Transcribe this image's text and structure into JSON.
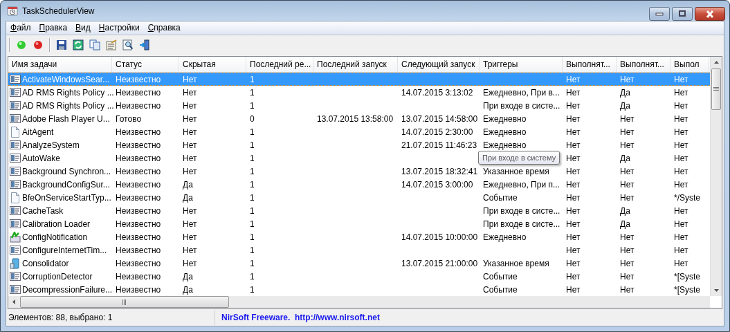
{
  "window": {
    "title": "TaskSchedulerView"
  },
  "menu": [
    {
      "label": "Файл"
    },
    {
      "label": "Правка"
    },
    {
      "label": "Вид"
    },
    {
      "label": "Настройки"
    },
    {
      "label": "Справка"
    }
  ],
  "table": {
    "columns": [
      "Имя задачи",
      "Статус",
      "Скрытая",
      "Последний ре...",
      "Последний запуск",
      "Следующий запуск",
      "Триггеры",
      "Выполнят...",
      "Выполнят...",
      "Выпол"
    ],
    "rows": [
      {
        "kind": "task",
        "selected": true,
        "name": "ActivateWindowsSear...",
        "status": "Неизвестно",
        "hidden": "Нет",
        "last_result": "1",
        "column_8": "Нет",
        "column_9": "Нет",
        "column_10": "Нет"
      },
      {
        "kind": "task",
        "selected": false,
        "name": "AD RMS Rights Policy ...",
        "status": "Неизвестно",
        "hidden": "Нет",
        "last_result": "1",
        "next_run": "14.07.2015 3:13:02",
        "triggers": "Ежедневно, При в...",
        "column_8": "Нет",
        "column_9": "Да",
        "column_10": "Нет"
      },
      {
        "kind": "task",
        "selected": false,
        "name": "AD RMS Rights Policy ...",
        "status": "Неизвестно",
        "hidden": "Нет",
        "last_result": "1",
        "triggers": "При входе в систе...",
        "column_8": "Нет",
        "column_9": "Да",
        "column_10": "Нет"
      },
      {
        "kind": "task",
        "selected": false,
        "name": "Adobe Flash Player U...",
        "status": "Готово",
        "hidden": "Нет",
        "last_result": "0",
        "last_run": "13.07.2015 13:58:00",
        "next_run": "13.07.2015 14:58:00",
        "triggers": "Ежедневно",
        "column_8": "Нет",
        "column_9": "Нет",
        "column_10": "Нет"
      },
      {
        "kind": "document",
        "selected": false,
        "name": "AitAgent",
        "status": "Неизвестно",
        "hidden": "Нет",
        "last_result": "1",
        "next_run": "14.07.2015 2:30:00",
        "triggers": "Ежедневно",
        "column_8": "Нет",
        "column_9": "Нет",
        "column_10": "Нет"
      },
      {
        "kind": "task",
        "selected": false,
        "name": "AnalyzeSystem",
        "status": "Неизвестно",
        "hidden": "Нет",
        "last_result": "1",
        "next_run": "21.07.2015 11:46:23",
        "triggers": "Ежедневно",
        "column_8": "Нет",
        "column_9": "Нет",
        "column_10": "Нет"
      },
      {
        "kind": "task",
        "selected": false,
        "name": "AutoWake",
        "status": "Неизвестно",
        "hidden": "Нет",
        "last_result": "1",
        "column_8": "Нет",
        "column_9": "Да",
        "column_10": "Нет"
      },
      {
        "kind": "task",
        "selected": false,
        "name": "Background Synchron...",
        "status": "Неизвестно",
        "hidden": "Нет",
        "last_result": "1",
        "next_run": "13.07.2015 18:32:41",
        "triggers": "Указанное время",
        "column_8": "Нет",
        "column_9": "Нет",
        "column_10": "Нет"
      },
      {
        "kind": "task",
        "selected": false,
        "name": "BackgroundConfigSur...",
        "status": "Неизвестно",
        "hidden": "Да",
        "last_result": "1",
        "next_run": "14.07.2015 3:00:00",
        "triggers": "Ежедневно, При п...",
        "column_8": "Нет",
        "column_9": "Нет",
        "column_10": "Нет"
      },
      {
        "kind": "document",
        "selected": false,
        "name": "BfeOnServiceStartTyp...",
        "status": "Неизвестно",
        "hidden": "Да",
        "last_result": "1",
        "triggers": "Событие",
        "column_8": "Нет",
        "column_9": "Нет",
        "column_10": "*/Syste"
      },
      {
        "kind": "task",
        "selected": false,
        "name": "CacheTask",
        "status": "Неизвестно",
        "hidden": "Нет",
        "last_result": "1",
        "triggers": "При входе в систе...",
        "column_8": "Нет",
        "column_9": "Да",
        "column_10": "Нет"
      },
      {
        "kind": "task",
        "selected": false,
        "name": "Calibration Loader",
        "status": "Неизвестно",
        "hidden": "Нет",
        "last_result": "1",
        "triggers": "При входе в систе...",
        "column_8": "Нет",
        "column_9": "Да",
        "column_10": "Нет"
      },
      {
        "kind": "tool",
        "selected": false,
        "name": "ConfigNotification",
        "status": "Неизвестно",
        "hidden": "Нет",
        "last_result": "1",
        "next_run": "14.07.2015 10:00:00",
        "triggers": "Ежедневно",
        "column_8": "Нет",
        "column_9": "Нет",
        "column_10": "Нет"
      },
      {
        "kind": "task",
        "selected": false,
        "name": "ConfigureInternetTim...",
        "status": "Неизвестно",
        "hidden": "Нет",
        "last_result": "1",
        "column_8": "Нет",
        "column_9": "Нет",
        "column_10": "Нет"
      },
      {
        "kind": "device",
        "selected": false,
        "name": "Consolidator",
        "status": "Неизвестно",
        "hidden": "Нет",
        "last_result": "1",
        "next_run": "13.07.2015 21:00:00",
        "triggers": "Указанное время",
        "column_8": "Нет",
        "column_9": "Нет",
        "column_10": "Нет"
      },
      {
        "kind": "task",
        "selected": false,
        "name": "CorruptionDetector",
        "status": "Неизвестно",
        "hidden": "Да",
        "last_result": "1",
        "triggers": "Событие",
        "column_8": "Нет",
        "column_9": "Нет",
        "column_10": "*[Syste"
      },
      {
        "kind": "task",
        "selected": false,
        "name": "DecompressionFailure...",
        "status": "Неизвестно",
        "hidden": "Да",
        "last_result": "1",
        "triggers": "Событие",
        "column_8": "Нет",
        "column_9": "Нет",
        "column_10": "*[Syste"
      }
    ]
  },
  "tooltip": {
    "text": "При входе в систему"
  },
  "status_bar": {
    "count": "Элементов: 88, выбрано: 1",
    "link": "NirSoft Freeware.  http://www.nirsoft.net"
  }
}
